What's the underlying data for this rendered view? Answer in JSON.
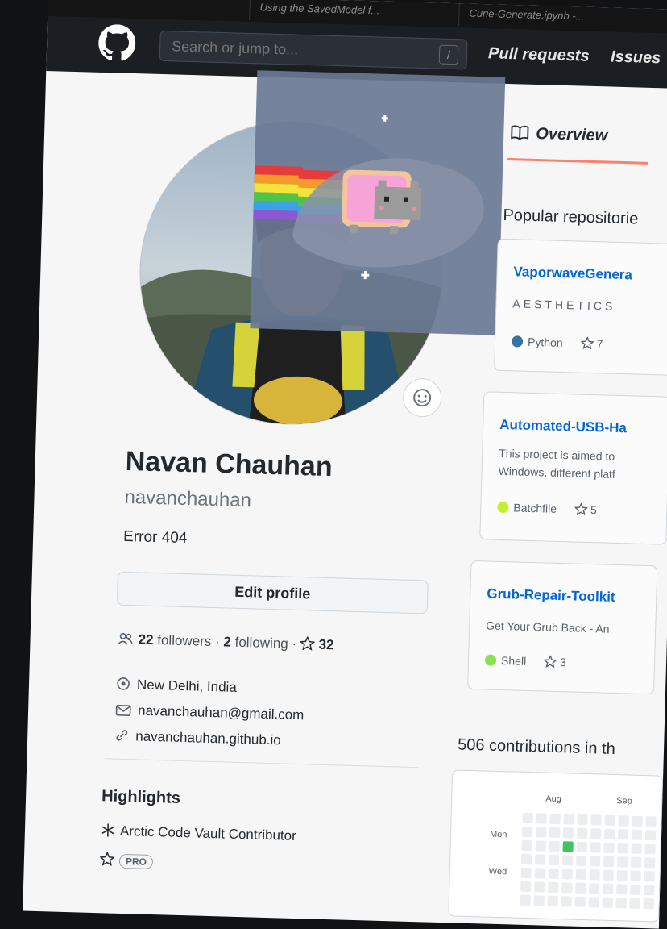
{
  "browser_tabs": [
    "Using the SavedModel f...",
    "Curie-Generate.ipynb -..."
  ],
  "header": {
    "search_placeholder": "Search or jump to...",
    "search_shortcut": "/",
    "nav": [
      "Pull requests",
      "Issues"
    ]
  },
  "profile": {
    "name": "Navan Chauhan",
    "login": "navanchauhan",
    "bio": "Error 404",
    "edit_profile": "Edit profile",
    "followers_count": "22",
    "followers_label": "followers",
    "following_count": "2",
    "following_label": "following",
    "stars_count": "32",
    "location": "New Delhi, India",
    "email": "navanchauhan@gmail.com",
    "website": "navanchauhan.github.io"
  },
  "highlights": {
    "title": "Highlights",
    "items": [
      "Arctic Code Vault Contributor",
      "PRO"
    ]
  },
  "tabs": {
    "overview": "Overview"
  },
  "popular": {
    "title": "Popular repositorie",
    "repos": [
      {
        "name": "VaporwaveGenera",
        "desc": [
          "AESTHETICS"
        ],
        "lang": "Python",
        "lang_color": "#3572A5",
        "stars": "7"
      },
      {
        "name": "Automated-USB-Ha",
        "desc": [
          "This project is aimed to",
          "Windows, different platf"
        ],
        "lang": "Batchfile",
        "lang_color": "#C1F12E",
        "stars": "5"
      },
      {
        "name": "Grub-Repair-Toolkit",
        "desc": [
          "Get Your Grub Back - An"
        ],
        "lang": "Shell",
        "lang_color": "#89E051",
        "stars": "3"
      }
    ]
  },
  "contributions": {
    "title": "506 contributions in th",
    "months": [
      "Aug",
      "Sep"
    ],
    "weekdays": [
      "Mon",
      "Wed"
    ]
  },
  "colors": {
    "accent_orange": "#f9826c",
    "link_blue": "#0366d6",
    "header_bg": "#1b1f23"
  }
}
